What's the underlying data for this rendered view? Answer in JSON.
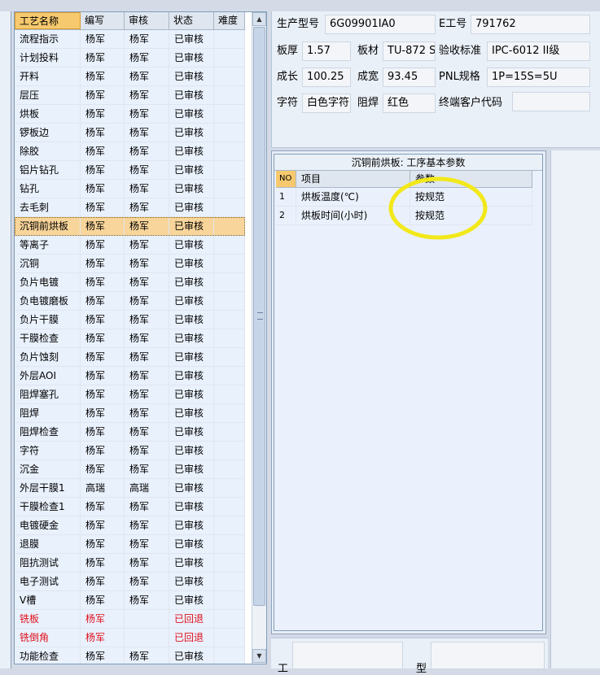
{
  "process_table": {
    "headers": [
      "工艺名称",
      "编写",
      "审核",
      "状态",
      "难度"
    ],
    "rows": [
      {
        "name": "流程指示",
        "writer": "杨军",
        "reviewer": "杨军",
        "status": "已审核",
        "difficulty": "",
        "style": "normal"
      },
      {
        "name": "计划投料",
        "writer": "杨军",
        "reviewer": "杨军",
        "status": "已审核",
        "difficulty": "",
        "style": "normal"
      },
      {
        "name": "开料",
        "writer": "杨军",
        "reviewer": "杨军",
        "status": "已审核",
        "difficulty": "",
        "style": "normal"
      },
      {
        "name": "层压",
        "writer": "杨军",
        "reviewer": "杨军",
        "status": "已审核",
        "difficulty": "",
        "style": "normal"
      },
      {
        "name": "烘板",
        "writer": "杨军",
        "reviewer": "杨军",
        "status": "已审核",
        "difficulty": "",
        "style": "normal"
      },
      {
        "name": "锣板边",
        "writer": "杨军",
        "reviewer": "杨军",
        "status": "已审核",
        "difficulty": "",
        "style": "normal"
      },
      {
        "name": "除胶",
        "writer": "杨军",
        "reviewer": "杨军",
        "status": "已审核",
        "difficulty": "",
        "style": "normal"
      },
      {
        "name": "铝片钻孔",
        "writer": "杨军",
        "reviewer": "杨军",
        "status": "已审核",
        "difficulty": "",
        "style": "normal"
      },
      {
        "name": "钻孔",
        "writer": "杨军",
        "reviewer": "杨军",
        "status": "已审核",
        "difficulty": "",
        "style": "normal"
      },
      {
        "name": "去毛刺",
        "writer": "杨军",
        "reviewer": "杨军",
        "status": "已审核",
        "difficulty": "",
        "style": "normal"
      },
      {
        "name": "沉铜前烘板",
        "writer": "杨军",
        "reviewer": "杨军",
        "status": "已审核",
        "difficulty": "",
        "style": "selected"
      },
      {
        "name": "等离子",
        "writer": "杨军",
        "reviewer": "杨军",
        "status": "已审核",
        "difficulty": "",
        "style": "normal"
      },
      {
        "name": "沉铜",
        "writer": "杨军",
        "reviewer": "杨军",
        "status": "已审核",
        "difficulty": "",
        "style": "normal"
      },
      {
        "name": "负片电镀",
        "writer": "杨军",
        "reviewer": "杨军",
        "status": "已审核",
        "difficulty": "",
        "style": "normal"
      },
      {
        "name": "负电镀磨板",
        "writer": "杨军",
        "reviewer": "杨军",
        "status": "已审核",
        "difficulty": "",
        "style": "normal"
      },
      {
        "name": "负片干膜",
        "writer": "杨军",
        "reviewer": "杨军",
        "status": "已审核",
        "difficulty": "",
        "style": "normal"
      },
      {
        "name": "干膜检查",
        "writer": "杨军",
        "reviewer": "杨军",
        "status": "已审核",
        "difficulty": "",
        "style": "normal"
      },
      {
        "name": "负片蚀刻",
        "writer": "杨军",
        "reviewer": "杨军",
        "status": "已审核",
        "difficulty": "",
        "style": "normal"
      },
      {
        "name": "外层AOI",
        "writer": "杨军",
        "reviewer": "杨军",
        "status": "已审核",
        "difficulty": "",
        "style": "normal"
      },
      {
        "name": "阻焊塞孔",
        "writer": "杨军",
        "reviewer": "杨军",
        "status": "已审核",
        "difficulty": "",
        "style": "normal"
      },
      {
        "name": "阻焊",
        "writer": "杨军",
        "reviewer": "杨军",
        "status": "已审核",
        "difficulty": "",
        "style": "normal"
      },
      {
        "name": "阻焊检查",
        "writer": "杨军",
        "reviewer": "杨军",
        "status": "已审核",
        "difficulty": "",
        "style": "normal"
      },
      {
        "name": "字符",
        "writer": "杨军",
        "reviewer": "杨军",
        "status": "已审核",
        "difficulty": "",
        "style": "normal"
      },
      {
        "name": "沉金",
        "writer": "杨军",
        "reviewer": "杨军",
        "status": "已审核",
        "difficulty": "",
        "style": "normal"
      },
      {
        "name": "外层干膜1",
        "writer": "高瑞",
        "reviewer": "高瑞",
        "status": "已审核",
        "difficulty": "",
        "style": "normal"
      },
      {
        "name": "干膜检查1",
        "writer": "杨军",
        "reviewer": "杨军",
        "status": "已审核",
        "difficulty": "",
        "style": "normal"
      },
      {
        "name": "电镀硬金",
        "writer": "杨军",
        "reviewer": "杨军",
        "status": "已审核",
        "difficulty": "",
        "style": "normal"
      },
      {
        "name": "退膜",
        "writer": "杨军",
        "reviewer": "杨军",
        "status": "已审核",
        "difficulty": "",
        "style": "normal"
      },
      {
        "name": "阻抗测试",
        "writer": "杨军",
        "reviewer": "杨军",
        "status": "已审核",
        "difficulty": "",
        "style": "normal"
      },
      {
        "name": "电子测试",
        "writer": "杨军",
        "reviewer": "杨军",
        "status": "已审核",
        "difficulty": "",
        "style": "normal"
      },
      {
        "name": "V槽",
        "writer": "杨军",
        "reviewer": "杨军",
        "status": "已审核",
        "difficulty": "",
        "style": "normal"
      },
      {
        "name": "铣板",
        "writer": "杨军",
        "reviewer": "",
        "status": "已回退",
        "difficulty": "",
        "style": "red"
      },
      {
        "name": "铣倒角",
        "writer": "杨军",
        "reviewer": "",
        "status": "已回退",
        "difficulty": "",
        "style": "red"
      },
      {
        "name": "功能检查",
        "writer": "杨军",
        "reviewer": "杨军",
        "status": "已审核",
        "difficulty": "",
        "style": "normal"
      }
    ]
  },
  "info": {
    "model_label": "生产型号",
    "model_value": "6G09901IA0",
    "eno_label": "E工号",
    "eno_value": "791762",
    "thickness_label": "板厚",
    "thickness_value": "1.57",
    "material_label": "板材",
    "material_value": "TU-872 S",
    "standard_label": "验收标准",
    "standard_value": "IPC-6012 II级",
    "length_label": "成长",
    "length_value": "100.25",
    "width_label": "成宽",
    "width_value": "93.45",
    "pnl_label": "PNL规格",
    "pnl_value": "1P=15S=5U",
    "char_label": "字符",
    "char_value": "白色字符",
    "mask_label": "阻焊",
    "mask_value": "红色",
    "customer_label": "终端客户代码",
    "customer_value": ""
  },
  "params": {
    "title": "沉铜前烘板: 工序基本参数",
    "headers": [
      "NO",
      "项目",
      "参数"
    ],
    "rows": [
      {
        "no": "1",
        "item": "烘板温度(℃)",
        "value": "按规范"
      },
      {
        "no": "2",
        "item": "烘板时间(小时)",
        "value": "按规范"
      }
    ]
  },
  "bottom": {
    "label_a": "工",
    "label_b": "型"
  },
  "colors": {
    "annotation_circle": "#f2e81a",
    "selected_row": "#f8d59a",
    "header_highlight": "#f6c96e",
    "rollback_text": "#e0101a"
  }
}
